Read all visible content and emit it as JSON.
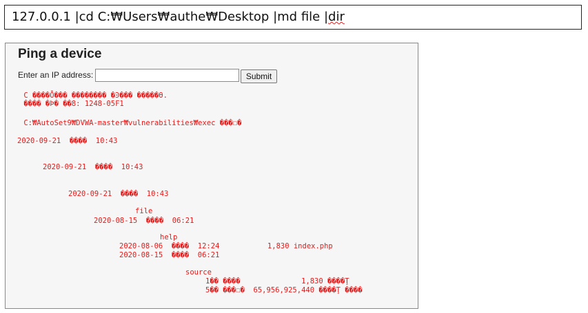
{
  "command_bar": {
    "text_main": "127.0.0.1 |cd C:₩Users₩authe₩Desktop |md file |",
    "text_flagged": "dir"
  },
  "panel": {
    "title": "Ping a device",
    "ip_label": "Enter an IP address:",
    "ip_value": "",
    "submit_label": "Submit"
  },
  "output": [
    " C ����Ȱ��� �������� �Ͽ��� �����Ө.",
    " ���� �Þ� ��8: 1248-05F1",
    " C:₩AutoSet9₩DVWA-master₩vulnerabilities₩exec ���☐�",
    "2020-09-21  ����  10:43",
    "2020-09-21  ����  10:43",
    "2020-09-21  ����  10:43",
    "file",
    "2020-08-15  ����  06:21",
    "help",
    "2020-08-06  ����  12:24           1,830 index.php",
    "2020-08-15  ����  06:21",
    "source",
    "1�� ����              1,830 ����Ţ",
    "5�� ���☐�  65,956,925,440 ����Ţ ����"
  ]
}
